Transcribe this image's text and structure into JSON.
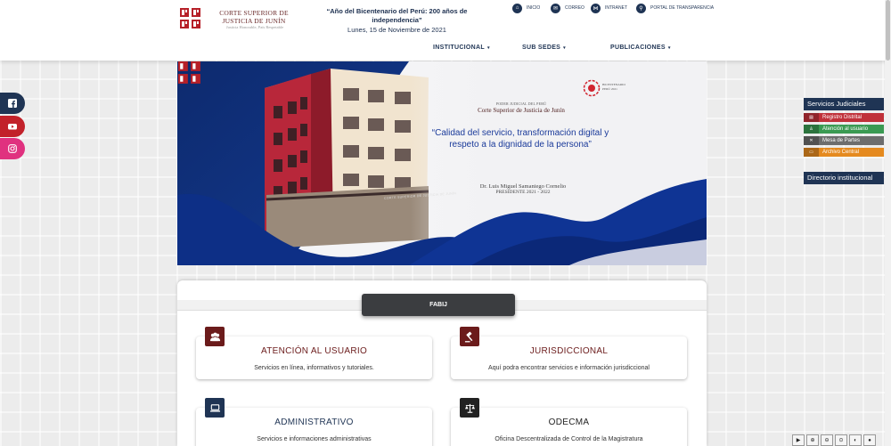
{
  "header": {
    "logo_title": "CORTE SUPERIOR DE JUSTICIA DE JUNÍN",
    "logo_subtitle": "Justicia Honorable, País Respetable",
    "headline": "“Año del Bicentenario del Perú: 200 años de independencia”",
    "date": "Lunes, 15 de Noviembre de 2021",
    "top_links": [
      {
        "label": "INICIO",
        "icon": "home-icon"
      },
      {
        "label": "CORREO",
        "icon": "mail-icon"
      },
      {
        "label": "INTRANET",
        "icon": "network-icon"
      },
      {
        "label": "PORTAL DE TRANSPARENCIA",
        "icon": "search-icon"
      }
    ],
    "nav": [
      {
        "label": "INSTITUCIONAL"
      },
      {
        "label": "SUB SEDES"
      },
      {
        "label": "PUBLICACIONES"
      }
    ],
    "caret": "▾"
  },
  "social": [
    {
      "name": "facebook-icon",
      "color": "#1f3454"
    },
    {
      "name": "youtube-icon",
      "color": "#c2212a"
    },
    {
      "name": "instagram-icon",
      "color": "#e0317f"
    }
  ],
  "banner": {
    "institution_small": "PODER JUDICIAL DEL PERÚ",
    "institution": "Corte Superior de Justicia de Junín",
    "bicentenario_line1": "BICENTENARIO",
    "bicentenario_line2": "PERÚ 2021",
    "quote": "“Calidad del servicio, transformación digital y respeto a la dignidad de la persona”",
    "signature_name": "Dr. Luis Miguel Samaniego Cornelio",
    "signature_role": "PRESIDENTE 2021 - 2022",
    "building_sign": "CORTE SUPERIOR DE JUSTICIA DE JUNÍN"
  },
  "right_panel": {
    "title": "Servicios Judiciales",
    "items": [
      {
        "label": "Registro Distrital",
        "color": "#c0313a"
      },
      {
        "label": "Atención al usuario",
        "color": "#3a9a52"
      },
      {
        "label": "Mesa de Partes",
        "color": "#6d6d6d"
      },
      {
        "label": "Archivo Central",
        "color": "#e58a1f"
      }
    ],
    "directory": "Directorio institucional"
  },
  "section": {
    "tab_label": "FABIJ",
    "cards": [
      {
        "title": "ATENCIÓN AL USUARIO",
        "desc": "Servicios en línea, informativos y tutoriales.",
        "icon": "users-icon",
        "icon_color": "#6b1b1b"
      },
      {
        "title": "JURISDICCIONAL",
        "desc": "Aquí podra encontrar servicios e información jurisdiccional",
        "icon": "gavel-icon",
        "icon_color": "#6b1b1b"
      },
      {
        "title": "ADMINISTRATIVO",
        "desc": "Servicios e informaciones administrativas",
        "icon": "laptop-icon",
        "icon_color": "#1f3454"
      },
      {
        "title": "ODECMA",
        "desc": "Oficina Descentralizada de Control de la Magistratura",
        "icon": "scales-icon",
        "icon_color": "#222222"
      }
    ]
  },
  "toolbar": {
    "buttons": [
      {
        "glyph": "▶",
        "name": "play-icon"
      },
      {
        "glyph": "⊕",
        "name": "zoom-in-icon"
      },
      {
        "glyph": "⊖",
        "name": "zoom-out-icon"
      },
      {
        "glyph": "⊙",
        "name": "zoom-reset-icon"
      },
      {
        "glyph": "◐",
        "name": "contrast-icon"
      },
      {
        "glyph": "●",
        "name": "dot-icon"
      }
    ]
  },
  "colors": {
    "navy": "#1f3454",
    "maroon": "#6b1b1b"
  }
}
